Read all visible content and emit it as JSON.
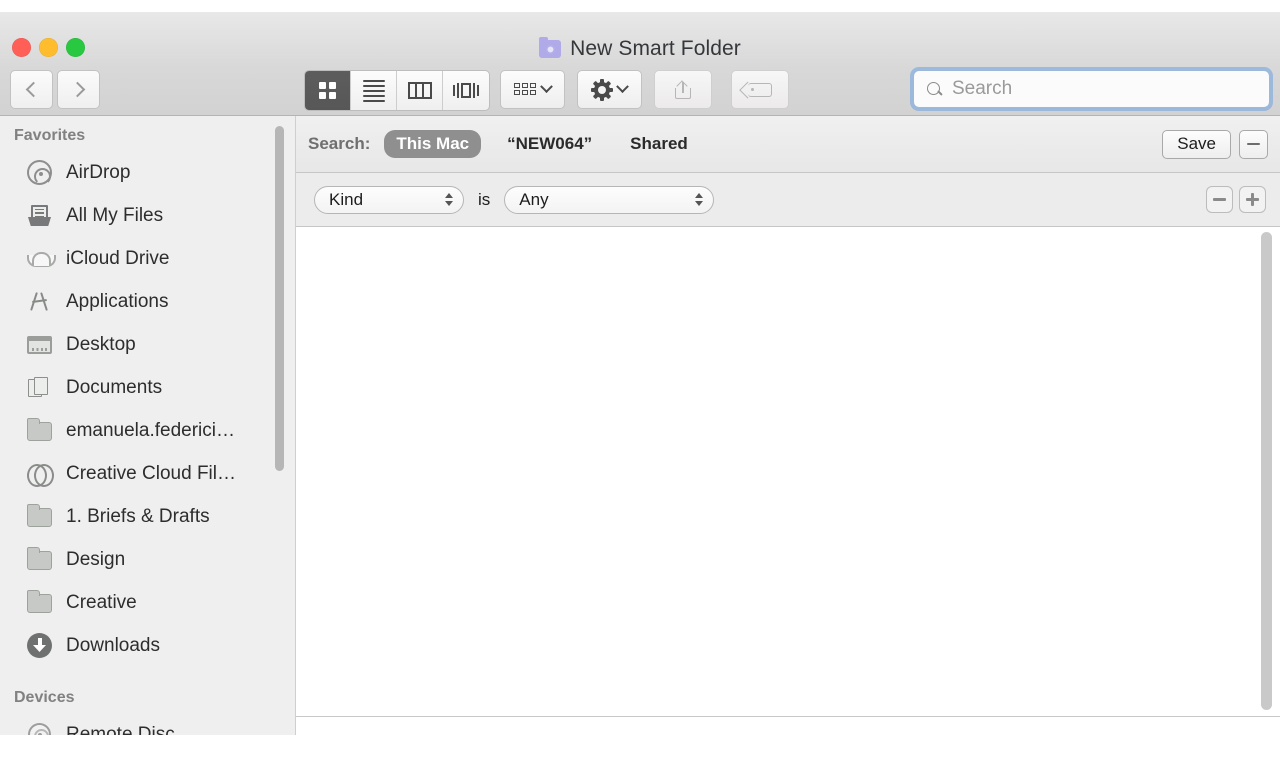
{
  "window": {
    "title": "New Smart Folder",
    "title_icon": "smart-folder-icon",
    "traffic_lights": [
      {
        "name": "close",
        "color": "#ff5f57"
      },
      {
        "name": "minimize",
        "color": "#ffbd2e"
      },
      {
        "name": "zoom",
        "color": "#28c840"
      }
    ]
  },
  "toolbar": {
    "back": "back-icon",
    "forward": "forward-icon",
    "views": [
      {
        "name": "icon-view",
        "active": true
      },
      {
        "name": "list-view",
        "active": false
      },
      {
        "name": "column-view",
        "active": false
      },
      {
        "name": "coverflow-view",
        "active": false
      }
    ],
    "arrange": "arrange-icon",
    "action": "gear-icon",
    "share": "share-icon",
    "tags": "tag-icon"
  },
  "search": {
    "placeholder": "Search",
    "value": "",
    "focused": true,
    "focus_ring_color": "#6ea0e0"
  },
  "scope_bar": {
    "label": "Search:",
    "options": [
      {
        "label": "This Mac",
        "selected": true
      },
      {
        "label": "“NEW064”",
        "selected": false
      },
      {
        "label": "Shared",
        "selected": false
      }
    ],
    "save_label": "Save",
    "remove_label": "remove-criteria-icon",
    "selected_pill_color": "#8f8f8f"
  },
  "filter_row": {
    "attribute": "Kind",
    "operator": "is",
    "value": "Any",
    "remove_icon": "minus-icon",
    "add_icon": "plus-icon"
  },
  "sidebar": {
    "sections": [
      {
        "header": "Favorites",
        "items": [
          {
            "label": "AirDrop",
            "icon": "airdrop-icon"
          },
          {
            "label": "All My Files",
            "icon": "all-my-files-icon"
          },
          {
            "label": "iCloud Drive",
            "icon": "icloud-drive-icon"
          },
          {
            "label": "Applications",
            "icon": "applications-icon"
          },
          {
            "label": "Desktop",
            "icon": "desktop-icon"
          },
          {
            "label": "Documents",
            "icon": "documents-icon"
          },
          {
            "label": "emanuela.federici…",
            "icon": "folder-icon"
          },
          {
            "label": "Creative Cloud Fil…",
            "icon": "creative-cloud-icon"
          },
          {
            "label": "1. Briefs & Drafts",
            "icon": "folder-icon"
          },
          {
            "label": "Design",
            "icon": "folder-icon"
          },
          {
            "label": "Creative",
            "icon": "folder-icon"
          },
          {
            "label": "Downloads",
            "icon": "downloads-icon"
          }
        ]
      },
      {
        "header": "Devices",
        "items": [
          {
            "label": "Remote Disc",
            "icon": "remote-disc-icon"
          }
        ]
      }
    ]
  },
  "content": {
    "results": [],
    "empty": true
  }
}
